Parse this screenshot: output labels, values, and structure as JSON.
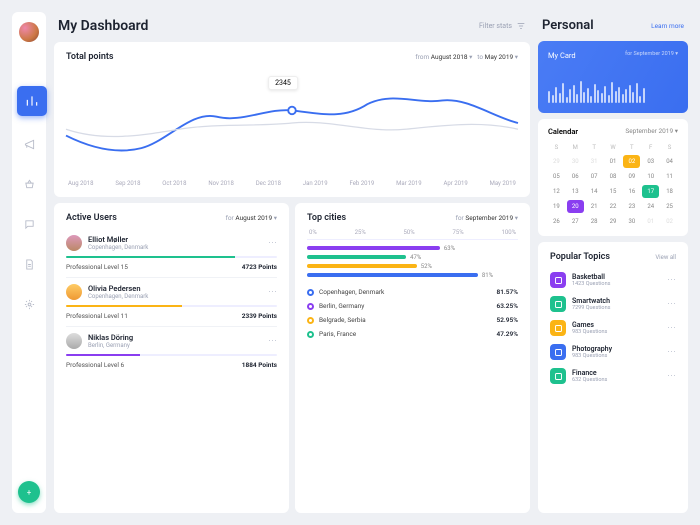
{
  "sidebar": {
    "nav": [
      "bar-chart-icon",
      "megaphone-icon",
      "basket-icon",
      "chat-icon",
      "document-icon",
      "gear-icon"
    ],
    "fab": "+"
  },
  "header": {
    "title": "My Dashboard",
    "filter": "Filter stats"
  },
  "chart": {
    "title": "Total points",
    "from_lbl": "from",
    "from_val": "August 2018",
    "to_lbl": "to",
    "to_val": "May 2019",
    "tooltip": "2345",
    "months": [
      "Aug 2018",
      "Sep 2018",
      "Oct 2018",
      "Nov 2018",
      "Dec 2018",
      "Jan 2019",
      "Feb 2019",
      "Mar 2019",
      "Apr 2019",
      "May 2019"
    ]
  },
  "chart_data": {
    "type": "line",
    "title": "Total points",
    "xlabel": "",
    "ylabel": "",
    "x": [
      "Aug 2018",
      "Sep 2018",
      "Oct 2018",
      "Nov 2018",
      "Dec 2018",
      "Jan 2019",
      "Feb 2019",
      "Mar 2019",
      "Apr 2019",
      "May 2019"
    ],
    "series": [
      {
        "name": "primary",
        "values": [
          1600,
          1300,
          2200,
          2000,
          2300,
          2345,
          2100,
          2600,
          2400,
          2100
        ]
      },
      {
        "name": "secondary",
        "values": [
          1800,
          1500,
          1900,
          2200,
          2100,
          2150,
          1900,
          1700,
          2200,
          1900
        ]
      }
    ],
    "highlight": {
      "x": "Jan 2019",
      "y": 2345
    }
  },
  "users": {
    "title": "Active Users",
    "for_lbl": "for",
    "for_val": "August 2019",
    "list": [
      {
        "name": "Elliot Møller",
        "loc": "Copenhagen, Denmark",
        "level_lbl": "Professional Level 15",
        "points": "4723 Points",
        "pct": 80,
        "color": "#1ec18e"
      },
      {
        "name": "Olivia Pedersen",
        "loc": "Copenhagen, Denmark",
        "level_lbl": "Professional Level 11",
        "points": "2339 Points",
        "pct": 55,
        "color": "#fbb415"
      },
      {
        "name": "Niklas Döring",
        "loc": "Berlin, Germany",
        "level_lbl": "Professional Level 6",
        "points": "1884 Points",
        "pct": 35,
        "color": "#8a3ef0"
      }
    ]
  },
  "cities": {
    "title": "Top cities",
    "for_lbl": "for",
    "for_val": "September 2019",
    "axis": [
      "0%",
      "25%",
      "50%",
      "75%",
      "100%"
    ],
    "bars": [
      {
        "pct": 63,
        "color": "#8a3ef0"
      },
      {
        "pct": 47,
        "color": "#1ec18e"
      },
      {
        "pct": 52,
        "color": "#fbb415"
      },
      {
        "pct": 81,
        "color": "#3a6ef0"
      }
    ],
    "legend": [
      {
        "name": "Copenhagen, Denmark",
        "pct": "81.57%",
        "color": "#3a6ef0"
      },
      {
        "name": "Berlin, Germany",
        "pct": "63.25%",
        "color": "#8a3ef0"
      },
      {
        "name": "Belgrade, Serbia",
        "pct": "52.95%",
        "color": "#fbb415"
      },
      {
        "name": "Paris, France",
        "pct": "47.29%",
        "color": "#1ec18e"
      }
    ]
  },
  "personal": {
    "title": "Personal",
    "learn": "Learn more"
  },
  "mycard": {
    "title": "My Card",
    "for_lbl": "for",
    "for_val": "September 2019"
  },
  "calendar": {
    "title": "Calendar",
    "month": "September 2019",
    "dow": [
      "S",
      "M",
      "T",
      "W",
      "T",
      "F",
      "S"
    ],
    "days": [
      {
        "d": 29,
        "c": "out"
      },
      {
        "d": 30,
        "c": "out"
      },
      {
        "d": 31,
        "c": "out"
      },
      {
        "d": "01",
        "c": ""
      },
      {
        "d": "02",
        "c": "y"
      },
      {
        "d": "03",
        "c": ""
      },
      {
        "d": "04",
        "c": ""
      },
      {
        "d": "05",
        "c": ""
      },
      {
        "d": "06",
        "c": ""
      },
      {
        "d": "07",
        "c": ""
      },
      {
        "d": "08",
        "c": ""
      },
      {
        "d": "09",
        "c": ""
      },
      {
        "d": 10,
        "c": ""
      },
      {
        "d": 11,
        "c": ""
      },
      {
        "d": 12,
        "c": ""
      },
      {
        "d": 13,
        "c": ""
      },
      {
        "d": 14,
        "c": ""
      },
      {
        "d": 15,
        "c": ""
      },
      {
        "d": 16,
        "c": ""
      },
      {
        "d": 17,
        "c": "g"
      },
      {
        "d": 18,
        "c": ""
      },
      {
        "d": 19,
        "c": ""
      },
      {
        "d": 20,
        "c": "p"
      },
      {
        "d": 21,
        "c": ""
      },
      {
        "d": 22,
        "c": ""
      },
      {
        "d": 23,
        "c": ""
      },
      {
        "d": 24,
        "c": ""
      },
      {
        "d": 25,
        "c": ""
      },
      {
        "d": 26,
        "c": ""
      },
      {
        "d": 27,
        "c": ""
      },
      {
        "d": 28,
        "c": ""
      },
      {
        "d": 29,
        "c": ""
      },
      {
        "d": 30,
        "c": ""
      },
      {
        "d": "01",
        "c": "out"
      },
      {
        "d": "02",
        "c": "out"
      }
    ]
  },
  "topics": {
    "title": "Popular Topics",
    "viewall": "View all",
    "list": [
      {
        "name": "Basketball",
        "q": "1423 Questions",
        "color": "#8a3ef0",
        "icon": "headphones-icon"
      },
      {
        "name": "Smartwatch",
        "q": "7299 Questions",
        "color": "#1ec18e",
        "icon": "watch-icon"
      },
      {
        "name": "Games",
        "q": "983 Questions",
        "color": "#fbb415",
        "icon": "gamepad-icon"
      },
      {
        "name": "Photography",
        "q": "983 Questions",
        "color": "#3a6ef0",
        "icon": "camera-icon"
      },
      {
        "name": "Finance",
        "q": "632 Questions",
        "color": "#1ec18e",
        "icon": "wallet-icon"
      }
    ]
  },
  "dots": "⋯"
}
